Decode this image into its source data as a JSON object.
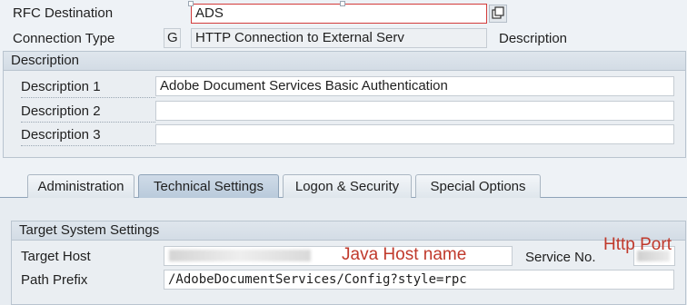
{
  "header": {
    "rfc_destination_label": "RFC Destination",
    "rfc_destination_value": "ADS",
    "connection_type_label": "Connection Type",
    "connection_type_code": "G",
    "connection_type_value": "HTTP Connection to External Serv",
    "connection_type_desc": "Description"
  },
  "description_group": {
    "title": "Description",
    "rows": [
      {
        "label": "Description 1",
        "value": "Adobe Document Services Basic Authentication"
      },
      {
        "label": "Description 2",
        "value": ""
      },
      {
        "label": "Description 3",
        "value": ""
      }
    ]
  },
  "tabs": [
    {
      "label": "Administration",
      "active": false
    },
    {
      "label": "Technical Settings",
      "active": true
    },
    {
      "label": "Logon & Security",
      "active": false
    },
    {
      "label": "Special Options",
      "active": false
    }
  ],
  "target_group": {
    "title": "Target System Settings",
    "target_host_label": "Target Host",
    "target_host_value": "",
    "service_no_label": "Service No.",
    "service_no_value": "",
    "path_prefix_label": "Path Prefix",
    "path_prefix_value": "/AdobeDocumentServices/Config?style=rpc"
  },
  "annotations": {
    "java_host": "Java Host name",
    "http_port": "Http Port"
  },
  "colors": {
    "annotation": "#c0392b",
    "active_tab": "#b9cadb"
  }
}
